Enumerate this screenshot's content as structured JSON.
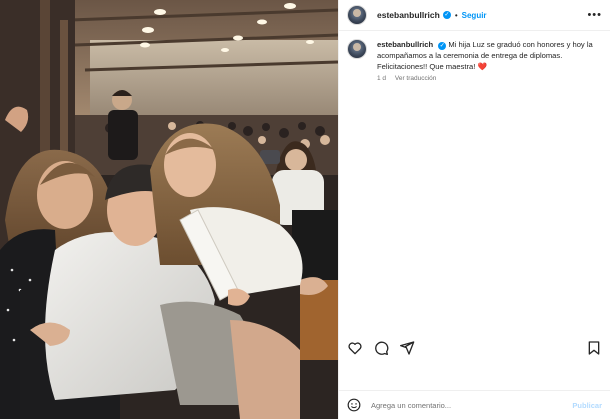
{
  "post": {
    "author": "estebanbullrich",
    "follow_label": "Seguir",
    "separator": "•",
    "more_label": "•••",
    "caption": "Mi hija Luz se graduó con honores y hoy la acompañamos a la ceremonia de entrega de diplomas. Felicitaciones!! Que maestra! ❤️",
    "time_ago": "1 d",
    "translate_label": "Ver traducción",
    "comment_placeholder": "Agrega un comentario...",
    "publish_label": "Publicar",
    "verified_glyph": "✓"
  },
  "icons": {
    "like": "heart-icon",
    "comment": "comment-icon",
    "share": "share-icon",
    "save": "bookmark-icon",
    "emoji": "emoji-icon",
    "verified": "verified-badge-icon"
  },
  "colors": {
    "accent": "#0095f6",
    "text": "#262626",
    "muted": "#737373",
    "publish_disabled": "#b3dbff",
    "heart": "#ed4956"
  }
}
